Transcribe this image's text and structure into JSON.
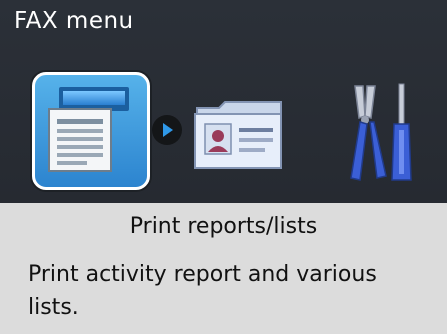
{
  "screen": {
    "title": "FAX menu",
    "selected_item": "Print reports/lists",
    "description": "Print activity report and various lists.",
    "icons": [
      "print-reports-icon",
      "contacts-folder-icon",
      "tools-icon",
      "next-arrow-icon"
    ]
  },
  "colors": {
    "top_background": "#2b3038",
    "bottom_background": "#dcdcdc",
    "selection_blue": "#3d9ee1",
    "arrow_blue": "#2f98e8"
  }
}
